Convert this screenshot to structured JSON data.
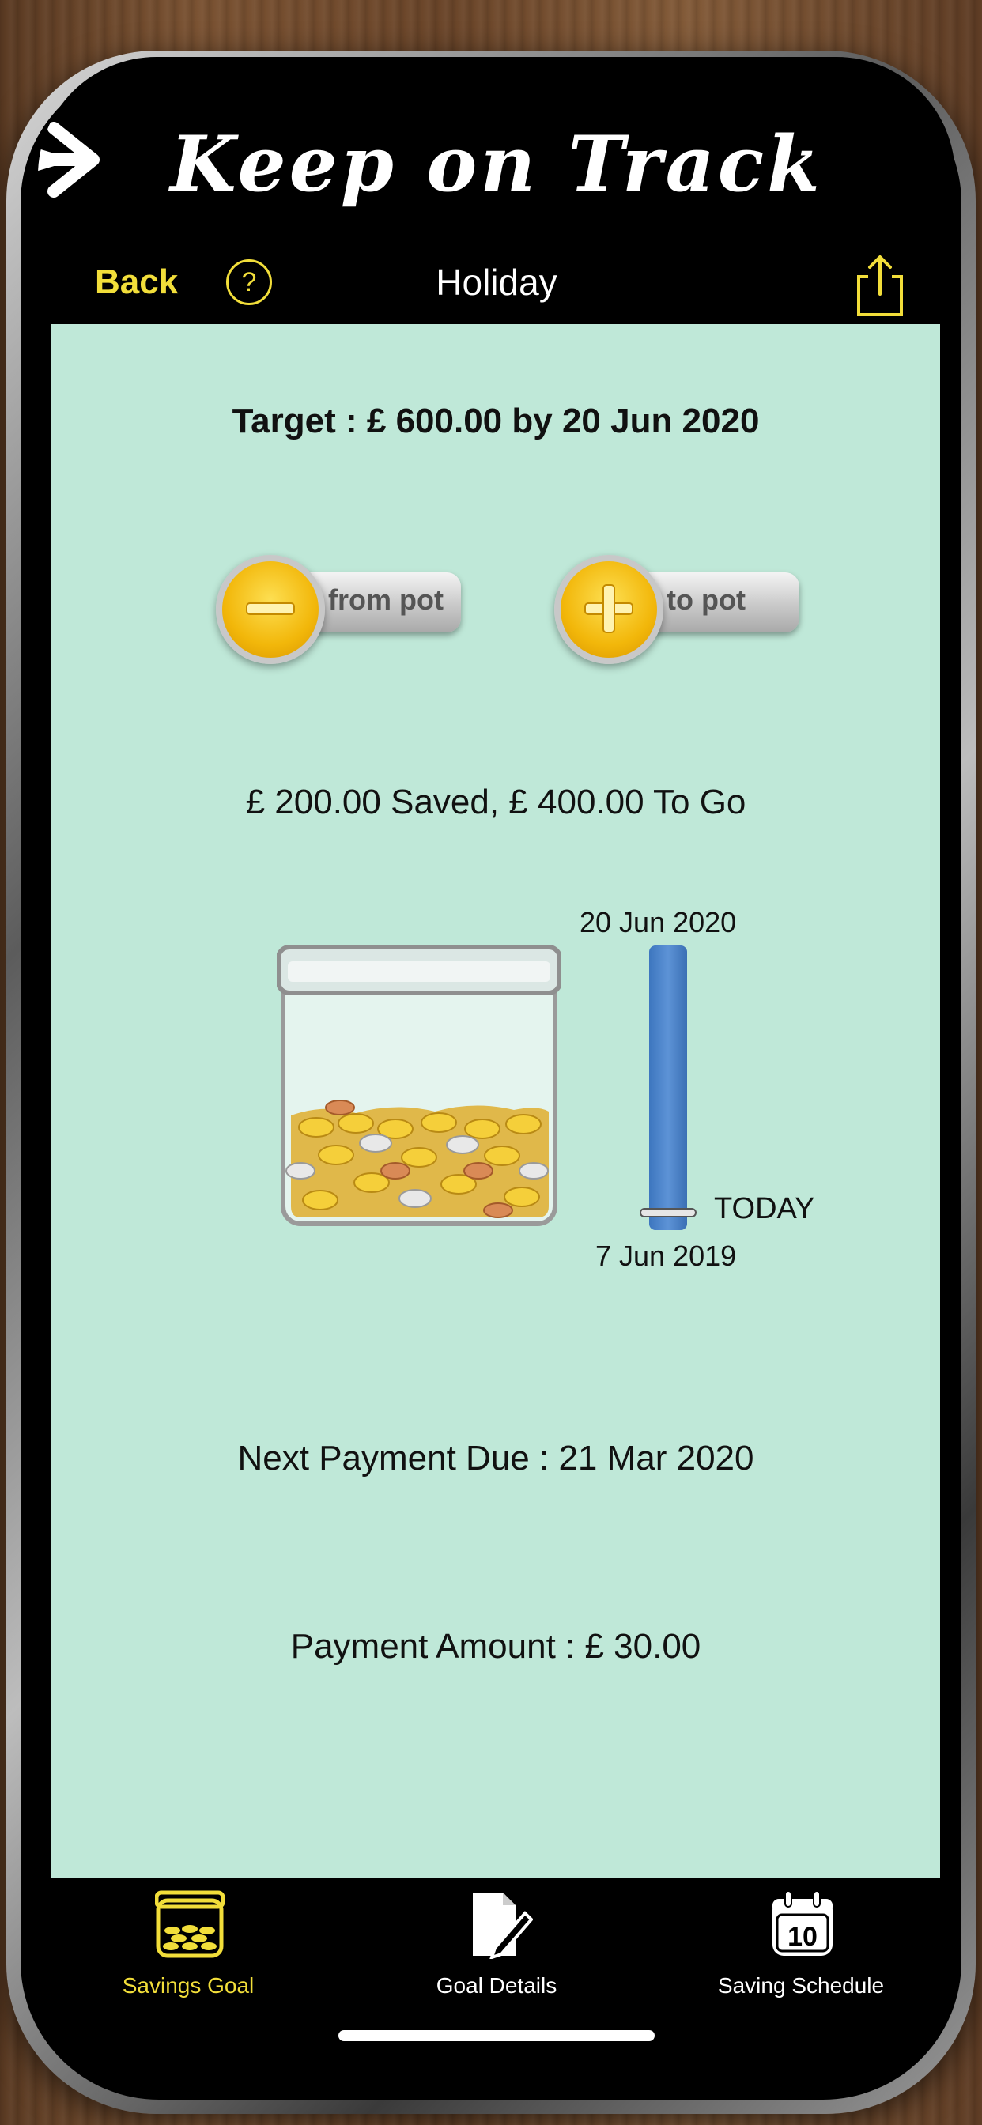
{
  "app": {
    "banner_title": "Keep on Track"
  },
  "navbar": {
    "back_label": "Back",
    "help_label": "?",
    "title": "Holiday"
  },
  "goal": {
    "target": "Target : £ 600.00 by 20 Jun 2020",
    "saved_summary": "£ 200.00 Saved, £ 400.00 To Go",
    "next_payment": "Next Payment Due : 21 Mar 2020",
    "payment_amount": "Payment Amount : £ 30.00"
  },
  "buttons": {
    "from_pot": "from pot",
    "to_pot": "to pot"
  },
  "timeline": {
    "end_date": "20 Jun 2020",
    "start_date": "7 Jun 2019",
    "today_label": "TODAY"
  },
  "tabs": [
    {
      "label": "Savings Goal",
      "icon": "coin-jar-icon",
      "active": true
    },
    {
      "label": "Goal Details",
      "icon": "document-edit-icon",
      "active": false
    },
    {
      "label": "Saving Schedule",
      "icon": "calendar-icon",
      "active": false,
      "badge": "10"
    }
  ],
  "colors": {
    "accent": "#f2de3a",
    "content_background": "#bfe8d8",
    "timeline_bar": "#4a84cc"
  }
}
